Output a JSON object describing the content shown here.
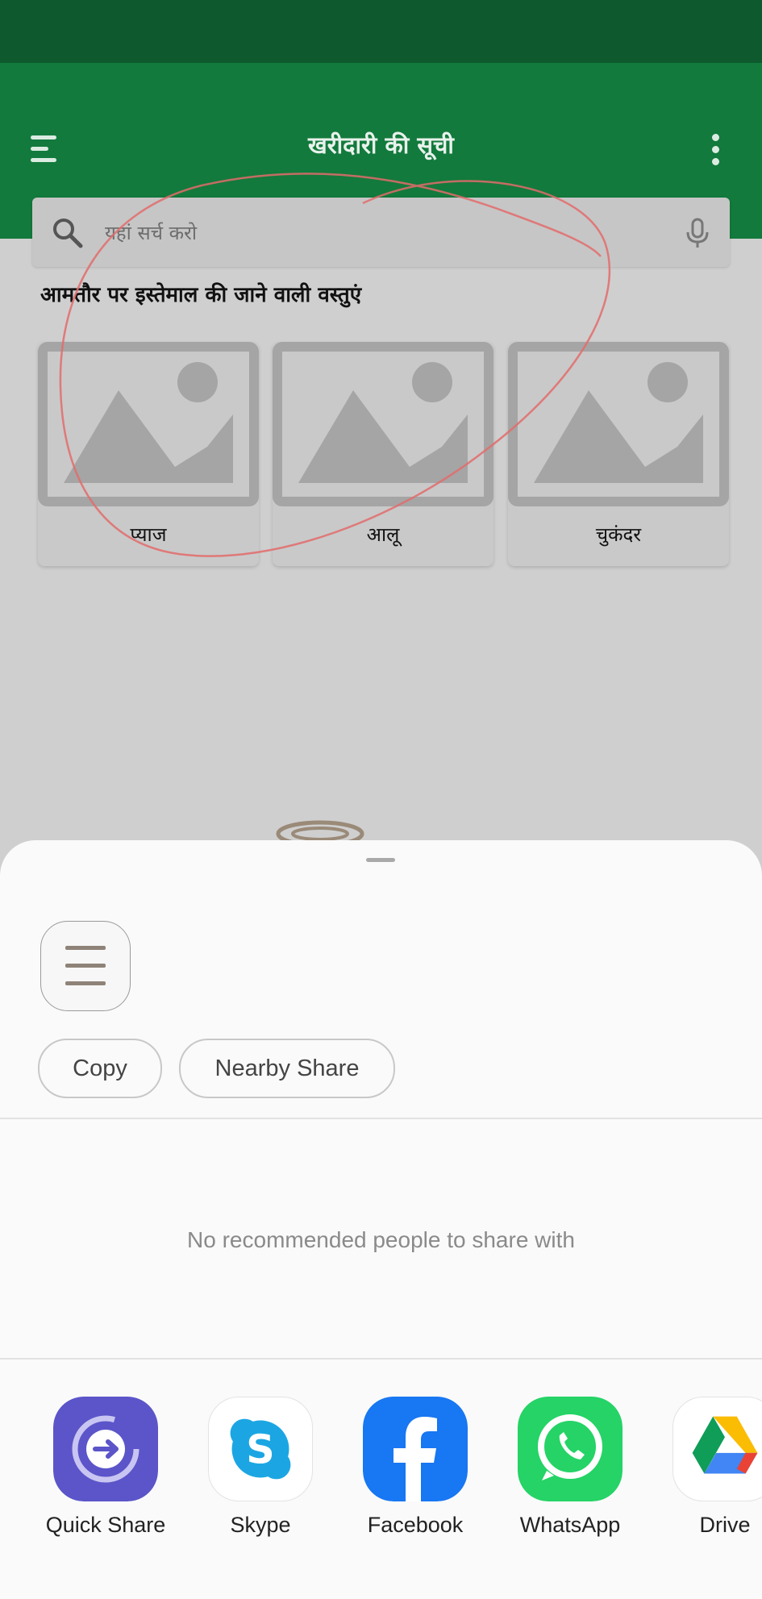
{
  "app_bar": {
    "title": "खरीदारी की सूची",
    "menu_icon": "hamburger-menu-icon",
    "more_icon": "more-vert-icon"
  },
  "search": {
    "placeholder": "यहां सर्च करो",
    "search_icon": "search-icon",
    "mic_icon": "mic-icon"
  },
  "common_items": {
    "heading": "आमतौर पर इस्तेमाल की जाने वाली वस्तुएं",
    "items": [
      {
        "label": "प्याज",
        "image_icon": "image-placeholder-icon"
      },
      {
        "label": "आलू",
        "image_icon": "image-placeholder-icon"
      },
      {
        "label": "चुकंदर",
        "image_icon": "image-placeholder-icon"
      }
    ]
  },
  "share_sheet": {
    "actions": {
      "copy": "Copy",
      "nearby_share": "Nearby Share"
    },
    "no_people_text": "No recommended people to share with",
    "apps": [
      {
        "label": "Quick Share",
        "icon": "quick-share-icon",
        "color": "#5b55c9"
      },
      {
        "label": "Skype",
        "icon": "skype-icon",
        "color": "#1ba6e3"
      },
      {
        "label": "Facebook",
        "icon": "facebook-icon",
        "color": "#1877f2"
      },
      {
        "label": "WhatsApp",
        "icon": "whatsapp-icon",
        "color": "#25d366"
      },
      {
        "label": "Drive",
        "icon": "google-drive-icon",
        "color": "#ffffff"
      }
    ]
  },
  "colors": {
    "status_bar": "#0e5a2e",
    "app_bar": "#127a3c",
    "scrim_background": "#cfcfcf",
    "annotation_stroke": "#e36b6b"
  }
}
